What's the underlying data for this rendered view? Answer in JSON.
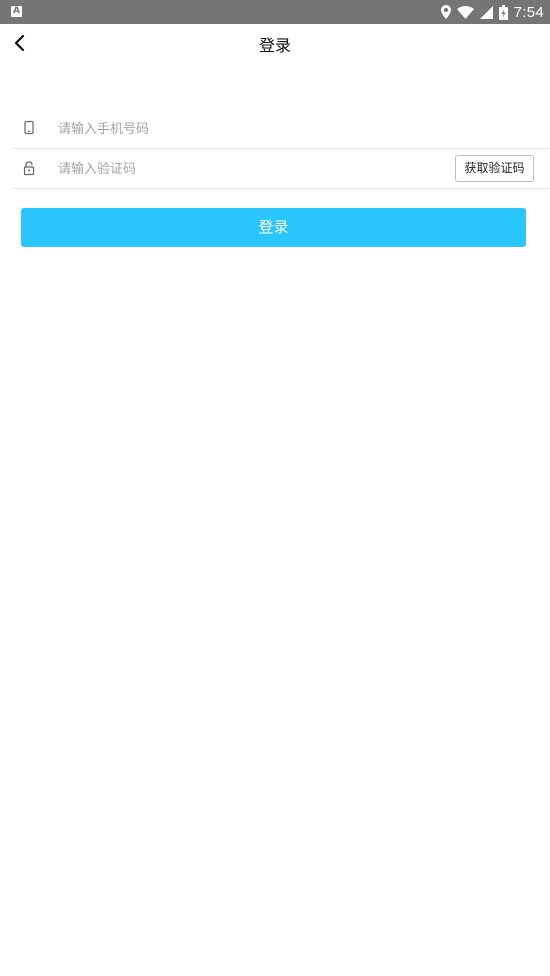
{
  "status_bar": {
    "notification_icon": "A",
    "time": "7:54",
    "icons": [
      "location-icon",
      "wifi-icon",
      "signal-icon",
      "battery-icon"
    ]
  },
  "header": {
    "title": "登录",
    "back_icon": "chevron-left-icon"
  },
  "form": {
    "phone": {
      "placeholder": "请输入手机号码",
      "icon": "phone-icon",
      "value": ""
    },
    "code": {
      "placeholder": "请输入验证码",
      "icon": "lock-icon",
      "value": "",
      "get_code_label": "获取验证码"
    }
  },
  "login_button": {
    "label": "登录"
  },
  "colors": {
    "status_bar": "#757575",
    "accent": "#29c5fb",
    "divider": "#e6e6e6",
    "placeholder": "#a4a4a4"
  }
}
